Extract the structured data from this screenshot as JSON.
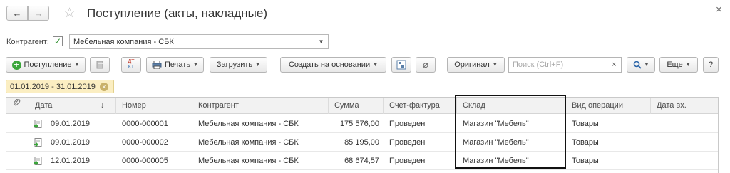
{
  "window": {
    "title": "Поступление (акты, накладные)",
    "back_icon": "←",
    "forward_icon": "→",
    "close_icon": "×"
  },
  "filter": {
    "counterparty_label": "Контрагент:",
    "counterparty_checked": true,
    "counterparty_value": "Мебельная компания - СБК"
  },
  "toolbar": {
    "receipt_label": "Поступление",
    "print_label": "Печать",
    "load_label": "Загрузить",
    "create_based_label": "Создать на основании",
    "original_label": "Оригинал",
    "search_placeholder": "Поиск (Ctrl+F)",
    "search_clear": "×",
    "more_label": "Еще",
    "help_label": "?",
    "dtkt_top": "ДТ",
    "dtkt_bottom": "КТ"
  },
  "period_tag": "01.01.2019 - 31.01.2019",
  "table": {
    "columns": [
      "Дата",
      "Номер",
      "Контрагент",
      "Сумма",
      "Счет-фактура",
      "Склад",
      "Вид операции",
      "Дата вх."
    ],
    "sort_indicator": "↓",
    "rows": [
      {
        "date": "09.01.2019",
        "number": "0000-000001",
        "counterparty": "Мебельная компания - СБК",
        "sum": "175 576,00",
        "invoice": "Проведен",
        "warehouse": "Магазин \"Мебель\"",
        "operation": "Товары",
        "in_date": ""
      },
      {
        "date": "09.01.2019",
        "number": "0000-000002",
        "counterparty": "Мебельная компания - СБК",
        "sum": "85 195,00",
        "invoice": "Проведен",
        "warehouse": "Магазин \"Мебель\"",
        "operation": "Товары",
        "in_date": ""
      },
      {
        "date": "12.01.2019",
        "number": "0000-000005",
        "counterparty": "Мебельная компания - СБК",
        "sum": "68 674,57",
        "invoice": "Проведен",
        "warehouse": "Магазин \"Мебель\"",
        "operation": "Товары",
        "in_date": ""
      }
    ]
  },
  "colors": {
    "accent_green": "#3aa53a",
    "tag_bg": "#fbeec2",
    "highlight_border": "#111111"
  }
}
